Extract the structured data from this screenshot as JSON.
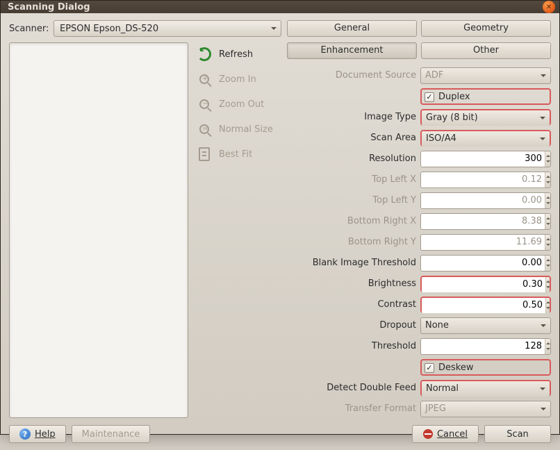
{
  "window": {
    "title": "Scanning Dialog"
  },
  "scanner": {
    "label": "Scanner:",
    "value": "EPSON Epson_DS-520"
  },
  "tools": {
    "refresh": "Refresh",
    "zoom_in": "Zoom In",
    "zoom_out": "Zoom Out",
    "normal_size": "Normal Size",
    "best_fit": "Best Fit"
  },
  "tabs": {
    "general": "General",
    "geometry": "Geometry",
    "enhancement": "Enhancement",
    "other": "Other"
  },
  "fields": {
    "document_source": {
      "label": "Document Source",
      "value": "ADF"
    },
    "duplex": {
      "label": "Duplex",
      "checked": true
    },
    "image_type": {
      "label": "Image Type",
      "value": "Gray (8 bit)"
    },
    "scan_area": {
      "label": "Scan Area",
      "value": "ISO/A4"
    },
    "resolution": {
      "label": "Resolution",
      "value": "300"
    },
    "top_left_x": {
      "label": "Top Left X",
      "value": "0.12"
    },
    "top_left_y": {
      "label": "Top Left Y",
      "value": "0.00"
    },
    "bottom_right_x": {
      "label": "Bottom Right X",
      "value": "8.38"
    },
    "bottom_right_y": {
      "label": "Bottom Right Y",
      "value": "11.69"
    },
    "blank_threshold": {
      "label": "Blank Image Threshold",
      "value": "0.00"
    },
    "brightness": {
      "label": "Brightness",
      "value": "0.30"
    },
    "contrast": {
      "label": "Contrast",
      "value": "0.50"
    },
    "dropout": {
      "label": "Dropout",
      "value": "None"
    },
    "threshold": {
      "label": "Threshold",
      "value": "128"
    },
    "deskew": {
      "label": "Deskew",
      "checked": true
    },
    "detect_double_feed": {
      "label": "Detect Double Feed",
      "value": "Normal"
    },
    "transfer_format": {
      "label": "Transfer Format",
      "value": "JPEG"
    }
  },
  "buttons": {
    "help": "Help",
    "maintenance": "Maintenance",
    "cancel": "Cancel",
    "scan": "Scan"
  }
}
